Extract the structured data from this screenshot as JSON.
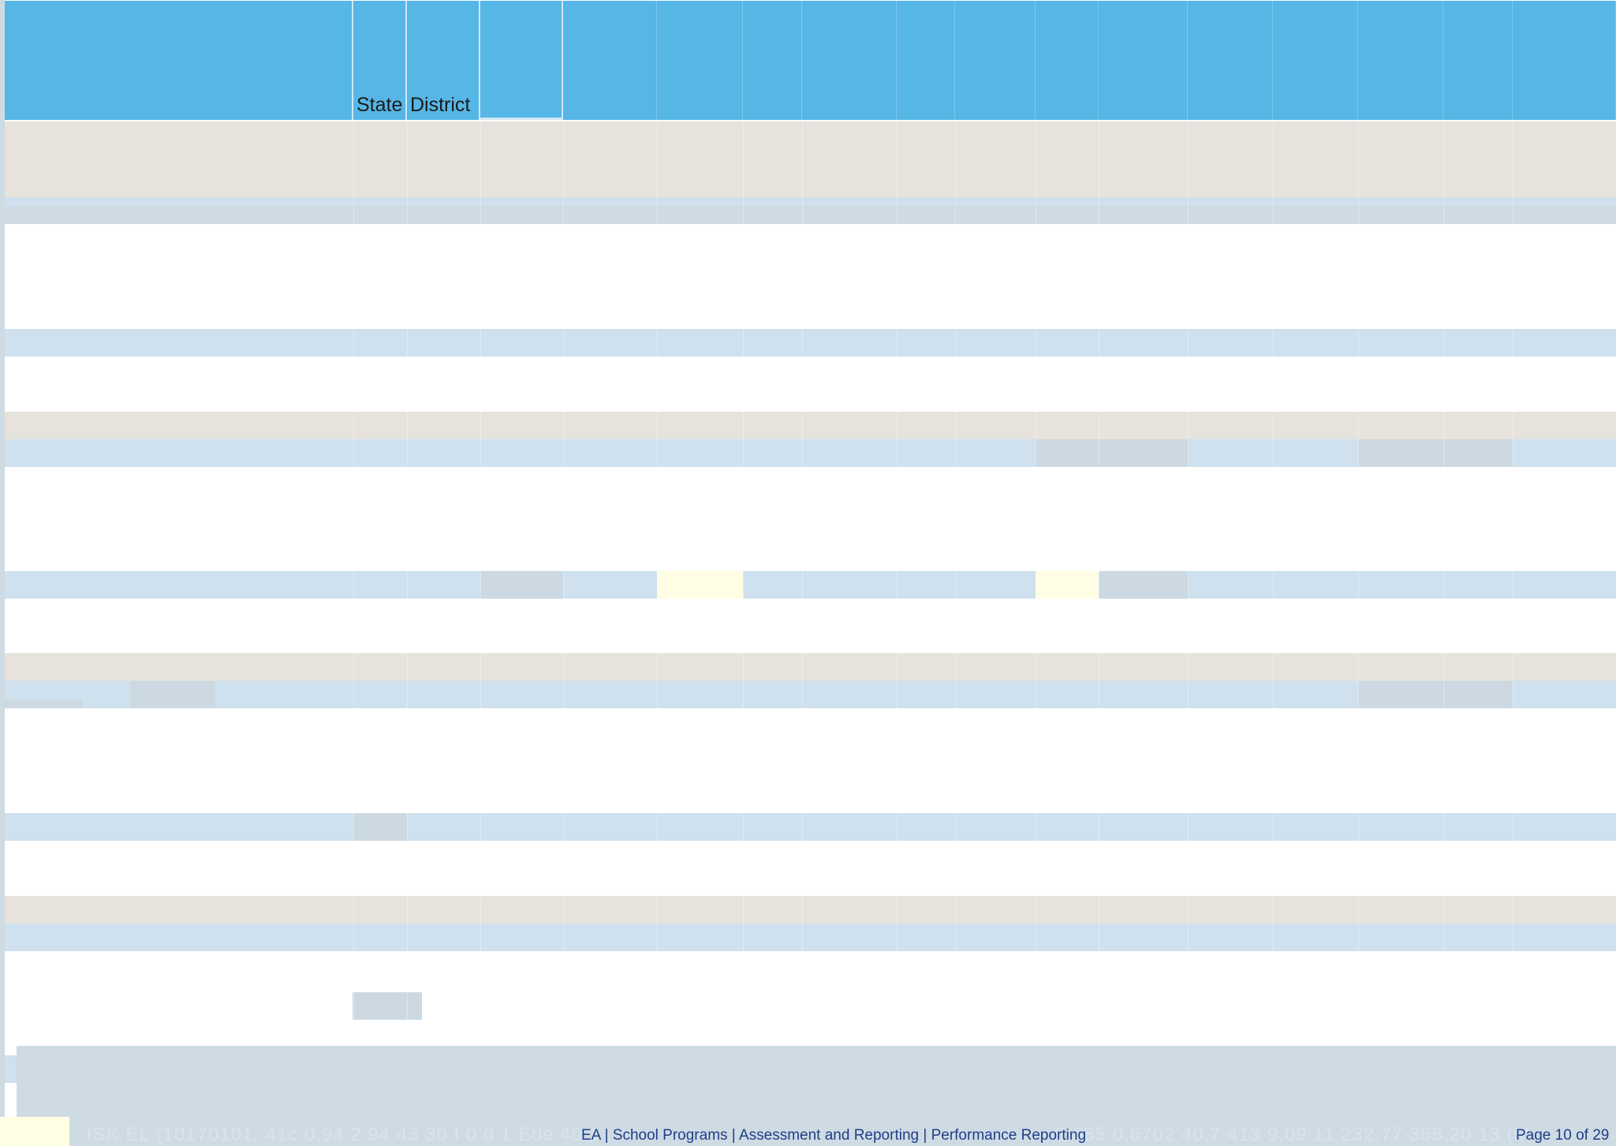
{
  "table": {
    "header": {
      "col_state": "State",
      "col_district": "District"
    }
  },
  "footer": {
    "links": "EA | School Programs | Assessment and Reporting | Performance Reporting",
    "ghost_text": "ISK EL (10170101. 41c 0.94 2.94 43 30 I 0 d 1 Ede 40.1",
    "ghost_text_right": "0.855 0.6702 40.7 413 9.09 11 232.77 355.20 13 (M",
    "page_label": "Page 10 of 29"
  },
  "colors": {
    "header_blue": "#56b6e6",
    "row_blue": "#cfe1ee",
    "row_beige": "#e6e3dc",
    "highlight_yellow": "#fffee4",
    "highlight_grey": "#ccd9e2",
    "link_blue": "#1f3d8a"
  }
}
